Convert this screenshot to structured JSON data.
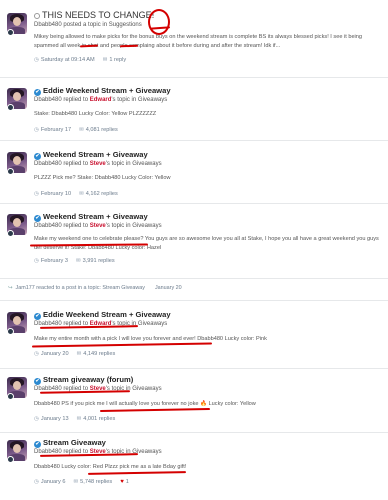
{
  "feed": [
    {
      "title": "THIS NEEDS TO CHANGE!",
      "meta_user": "Dbabb480",
      "meta_action": " posted a topic in ",
      "meta_forum": "Suggestions",
      "snippet": "Mikey being allowed to make picks for the bonus buys on the weekend stream is complete BS its always blessed picks! I see it being spammed all week in chat and people complaing about it before during and after the stream! Idk if...",
      "date": "Saturday at 09:14 AM",
      "replies": "1 reply"
    },
    {
      "title": "Eddie Weekend Stream + Giveaway",
      "meta_user": "Dbabb480",
      "meta_action": " replied to ",
      "meta_owner": "Edward",
      "meta_suffix": "'s topic in Giveaways",
      "snippet": "Stake: Dbabb480 Lucky Color: Yellow PLZZZZZZ",
      "date": "February 17",
      "replies": "4,081 replies"
    },
    {
      "title": "Weekend Stream + Giveaway",
      "meta_user": "Dbabb480",
      "meta_action": " replied to ",
      "meta_owner": "Steve",
      "meta_suffix": "'s topic in Giveaways",
      "snippet": "PLZZZ Pick me? Stake: Dbabb480 Lucky Color: Yellow",
      "date": "February 10",
      "replies": "4,162 replies"
    },
    {
      "title": "Weekend Stream + Giveaway",
      "meta_user": "Dbabb480",
      "meta_action": " replied to ",
      "meta_owner": "Steve",
      "meta_suffix": "'s topic in Giveaways",
      "snippet": "Make my weekend one to celebrate please? You guys are so awesome love you all at Stake, I hope you all have a great weekend you guys def deserve it! Stake: Dbabb480 Lucky color: Hazel",
      "date": "February 3",
      "replies": "3,991 replies"
    },
    {
      "title": "Eddie Weekend Stream + Giveaway",
      "meta_user": "Dbabb480",
      "meta_action": " replied to ",
      "meta_owner": "Edward",
      "meta_suffix": "'s topic in Giveaways",
      "snippet": "Make my entire month with a pick I will love you forever and ever! Dbabb480 Lucky color: Pink",
      "date": "January 20",
      "replies": "4,149 replies"
    },
    {
      "title": "Stream giveaway (forum)",
      "meta_user": "Dbabb480",
      "meta_action": " replied to ",
      "meta_owner": "Steve",
      "meta_suffix": "'s topic in Giveaways",
      "snippet_a": "Dbabb480 PS if you pick me I will actually love you forever no joke ",
      "snippet_b": " Lucky color: Yellow",
      "date": "January 13",
      "replies": "4,001 replies"
    },
    {
      "title": "Stream Giveaway",
      "meta_user": "Dbabb480",
      "meta_action": " replied to ",
      "meta_owner": "Steve",
      "meta_suffix": "'s topic in Giveaways",
      "snippet": "Dbabb480 Lucky color: Red Plzzz pick me as a late Bday gift!",
      "date": "January 6",
      "replies": "5,748 replies",
      "likes": "1"
    }
  ],
  "activity": {
    "text": "Jam177 reacted to a post in a topic: Stream Giveaway",
    "date": "January 20"
  },
  "colors": {
    "accent_red": "#c8102e",
    "annotation_red": "#d40000",
    "meta_gray": "#6b7b8c"
  }
}
